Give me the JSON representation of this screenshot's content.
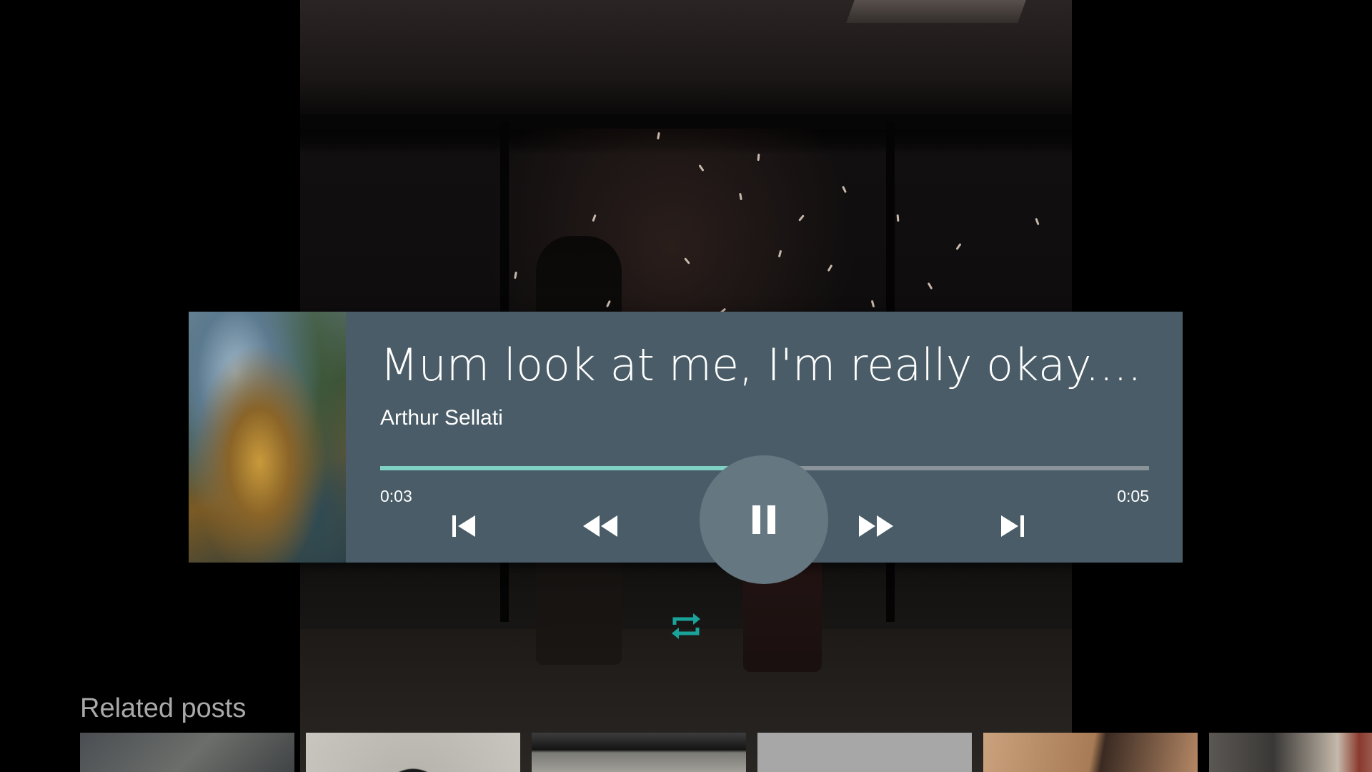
{
  "player": {
    "title": "Mum look at me, I'm really okay....",
    "artist": "Arthur Sellati",
    "elapsed": "0:03",
    "duration": "0:05",
    "progress_fraction": 0.536,
    "progress_color": "#7fd1c3",
    "panel_color": "#4a5c67",
    "is_playing": true,
    "controls": {
      "previous_icon": "skip-previous-icon",
      "rewind_icon": "rewind-icon",
      "pause_icon": "pause-icon",
      "fast_forward_icon": "fast-forward-icon",
      "next_icon": "skip-next-icon"
    },
    "repeat_icon": "repeat-icon",
    "repeat_color": "#1aa39a"
  },
  "related": {
    "label": "Related posts"
  }
}
